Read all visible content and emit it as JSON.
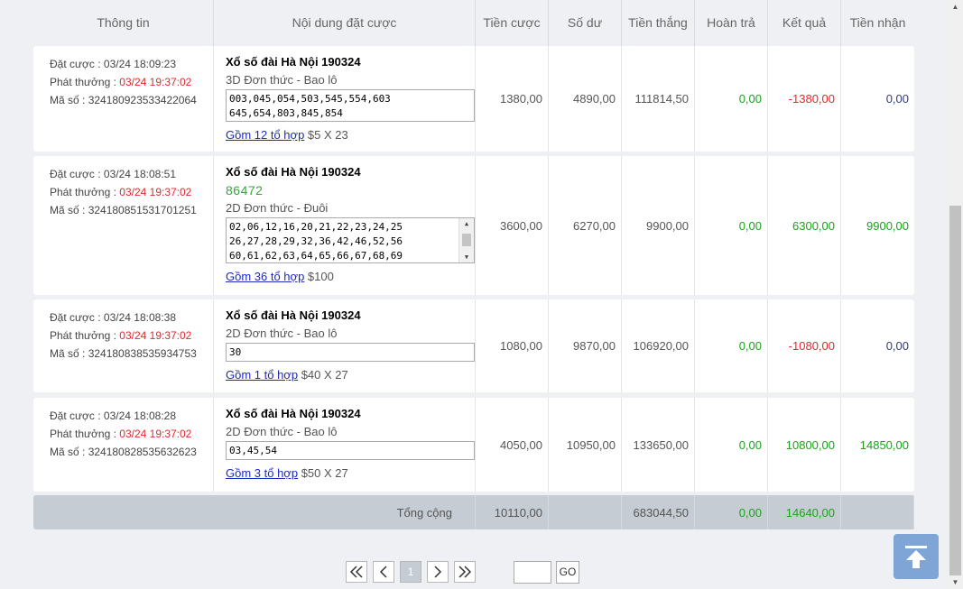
{
  "header": {
    "cols": [
      "Thông tin",
      "Nội dung đặt cược",
      "Tiền cược",
      "Số dư",
      "Tiền thắng",
      "Hoàn trả",
      "Kết quả",
      "Tiền nhận"
    ]
  },
  "labels": {
    "bet_time": "Đặt cược : ",
    "prize_time": "Phát thưởng : ",
    "code": "Mã số : "
  },
  "rows": [
    {
      "bet_time": "03/24 18:09:23",
      "prize_time": "03/24 19:37:02",
      "code": "324180923533422064",
      "title": "Xổ số đài Hà Nội 190324",
      "result": "",
      "type": "3D Đơn thức - Bao lô",
      "numbers_line1": "003,045,054,503,545,554,603",
      "numbers_line2": "645,654,803,845,854",
      "numbers_line3": "",
      "combo_link": "Gồm 12 tổ hợp",
      "combo_price": " $5 X 23",
      "stake": "1380,00",
      "balance": "4890,00",
      "win": "111814,50",
      "refund": "0,00",
      "result_amount": "-1380,00",
      "received": "0,00"
    },
    {
      "bet_time": "03/24 18:08:51",
      "prize_time": "03/24 19:37:02",
      "code": "324180851531701251",
      "title": "Xổ số đài Hà Nội 190324",
      "result": "86472",
      "type": "2D Đơn thức - Đuôi",
      "numbers_line1": "02,06,12,16,20,21,22,23,24,25",
      "numbers_line2": "26,27,28,29,32,36,42,46,52,56",
      "numbers_line3": "60,61,62,63,64,65,66,67,68,69",
      "combo_link": "Gồm 36 tổ hợp",
      "combo_price": " $100",
      "stake": "3600,00",
      "balance": "6270,00",
      "win": "9900,00",
      "refund": "0,00",
      "result_amount": "6300,00",
      "received": "9900,00"
    },
    {
      "bet_time": "03/24 18:08:38",
      "prize_time": "03/24 19:37:02",
      "code": "324180838535934753",
      "title": "Xổ số đài Hà Nội 190324",
      "result": "",
      "type": "2D Đơn thức - Bao lô",
      "numbers_line1": "30",
      "numbers_line2": "",
      "numbers_line3": "",
      "combo_link": "Gồm 1 tổ hợp",
      "combo_price": " $40 X 27",
      "stake": "1080,00",
      "balance": "9870,00",
      "win": "106920,00",
      "refund": "0,00",
      "result_amount": "-1080,00",
      "received": "0,00"
    },
    {
      "bet_time": "03/24 18:08:28",
      "prize_time": "03/24 19:37:02",
      "code": "324180828535632623",
      "title": "Xổ số đài Hà Nội 190324",
      "result": "",
      "type": "2D Đơn thức - Bao lô",
      "numbers_line1": "03,45,54",
      "numbers_line2": "",
      "numbers_line3": "",
      "combo_link": "Gồm 3 tổ hợp",
      "combo_price": " $50 X 27",
      "stake": "4050,00",
      "balance": "10950,00",
      "win": "133650,00",
      "refund": "0,00",
      "result_amount": "10800,00",
      "received": "14850,00"
    }
  ],
  "total": {
    "label": "Tổng cộng",
    "stake": "10110,00",
    "balance": "",
    "win": "683044,50",
    "refund": "0,00",
    "result_amount": "14640,00",
    "received": ""
  },
  "pager": {
    "current_page": "1",
    "go_label": "GO",
    "go_value": ""
  },
  "colors": {
    "positive": "#1aa31a",
    "negative": "#e0282e",
    "link": "#1d2bbf",
    "accent": "#7ea5d6"
  }
}
